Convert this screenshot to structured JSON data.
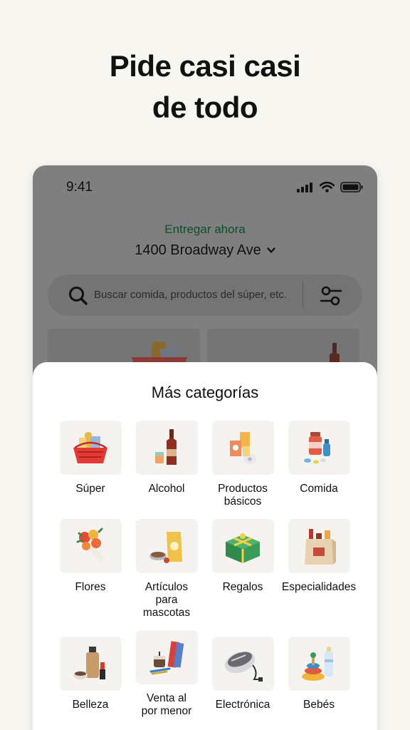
{
  "headline": {
    "line1": "Pide casi casi",
    "line2": "de todo"
  },
  "status": {
    "time": "9:41"
  },
  "delivery": {
    "label": "Entregar ahora",
    "address": "1400 Broadway Ave"
  },
  "search": {
    "placeholder": "Buscar comida, productos del súper, etc."
  },
  "sheet": {
    "title": "Más categorías",
    "categories": [
      {
        "label": "Súper",
        "icon": "grocery-basket-icon"
      },
      {
        "label": "Alcohol",
        "icon": "wine-bottle-icon"
      },
      {
        "label": "Productos básicos",
        "icon": "household-icon"
      },
      {
        "label": "Comida",
        "icon": "pharmacy-icon"
      },
      {
        "label": "Flores",
        "icon": "flowers-icon"
      },
      {
        "label": "Artículos para mascotas",
        "icon": "pet-food-icon"
      },
      {
        "label": "Regalos",
        "icon": "gift-icon"
      },
      {
        "label": "Especialidades",
        "icon": "specialty-bag-icon"
      },
      {
        "label": "Belleza",
        "icon": "beauty-icon"
      },
      {
        "label": "Venta al por menor",
        "icon": "books-candle-icon"
      },
      {
        "label": "Electrónica",
        "icon": "mouse-icon"
      },
      {
        "label": "Bebés",
        "icon": "baby-toys-icon"
      }
    ]
  },
  "colors": {
    "background": "#f8f6f1",
    "accent_green": "#0c4f2b",
    "overlay": "#7f7f7f",
    "sheet": "#ffffff"
  }
}
